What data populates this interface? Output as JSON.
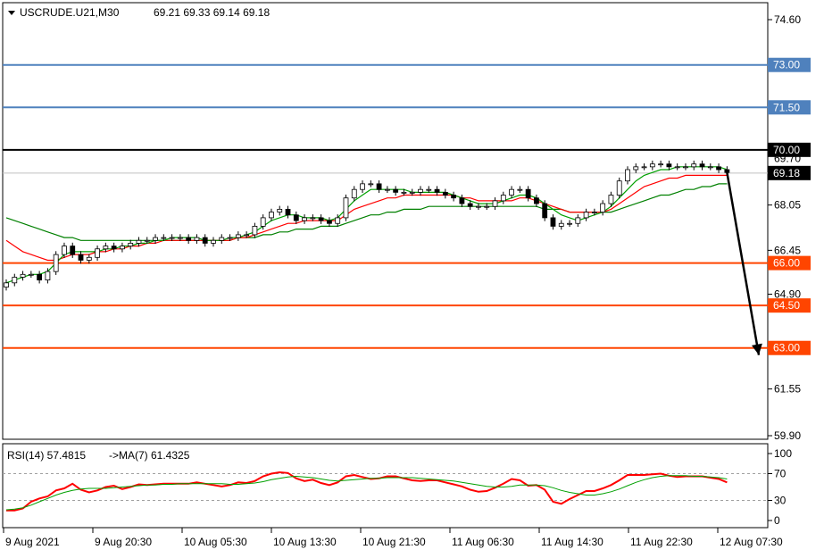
{
  "header": {
    "symbol": "USCRUDE.U21,M30",
    "ohlc": "69.21 69.33 69.14 69.18"
  },
  "rsi_header": {
    "label": "RSI(14) 57.4815",
    "ma_label": "->MA(7) 61.4325"
  },
  "chart_data": {
    "type": "candlestick",
    "price_axis": {
      "range": [
        59.9,
        74.6
      ],
      "ticks": [
        "74.60",
        "71.55",
        "68.05",
        "66.45",
        "64.90",
        "61.55",
        "59.90"
      ]
    },
    "x_labels": [
      "9 Aug 2021",
      "9 Aug 20:30",
      "10 Aug 05:30",
      "10 Aug 13:30",
      "10 Aug 21:30",
      "11 Aug 06:30",
      "11 Aug 14:30",
      "11 Aug 22:30",
      "12 Aug 07:30"
    ],
    "levels": [
      {
        "value": 73.0,
        "label": "73.00",
        "color": "#4f81bd"
      },
      {
        "value": 71.5,
        "label": "71.50",
        "color": "#4f81bd"
      },
      {
        "value": 70.0,
        "label": "70.00",
        "color": "#000000"
      },
      {
        "value": 66.0,
        "label": "66.00",
        "color": "#ff4500"
      },
      {
        "value": 64.5,
        "label": "64.50",
        "color": "#ff4500"
      },
      {
        "value": 63.0,
        "label": "63.00",
        "color": "#ff4500"
      }
    ],
    "current_price": {
      "value": 69.18,
      "label": "69.18"
    },
    "partial_tick": "69.70",
    "close_series": [
      65.3,
      65.5,
      65.6,
      65.6,
      65.4,
      65.7,
      66.3,
      66.6,
      66.3,
      66.1,
      66.2,
      66.5,
      66.6,
      66.5,
      66.6,
      66.7,
      66.8,
      66.8,
      66.9,
      66.9,
      66.9,
      66.9,
      66.8,
      66.9,
      66.7,
      66.8,
      66.9,
      66.9,
      67.0,
      67.0,
      67.3,
      67.6,
      67.8,
      67.9,
      67.7,
      67.5,
      67.6,
      67.6,
      67.5,
      67.4,
      67.6,
      68.3,
      68.6,
      68.8,
      68.8,
      68.6,
      68.6,
      68.5,
      68.5,
      68.5,
      68.6,
      68.6,
      68.5,
      68.4,
      68.3,
      68.1,
      68.0,
      68.0,
      68.0,
      68.2,
      68.4,
      68.6,
      68.6,
      68.3,
      68.1,
      67.6,
      67.3,
      67.4,
      67.4,
      67.6,
      67.8,
      67.8,
      68.1,
      68.4,
      68.9,
      69.3,
      69.4,
      69.4,
      69.5,
      69.5,
      69.4,
      69.4,
      69.4,
      69.5,
      69.4,
      69.4,
      69.3,
      69.2
    ],
    "ma_fast": [
      65.3,
      65.4,
      65.5,
      65.6,
      65.6,
      65.7,
      66.0,
      66.3,
      66.4,
      66.4,
      66.4,
      66.4,
      66.5,
      66.5,
      66.6,
      66.6,
      66.7,
      66.7,
      66.8,
      66.8,
      66.9,
      66.9,
      66.9,
      66.9,
      66.8,
      66.8,
      66.8,
      66.9,
      66.9,
      67.0,
      67.1,
      67.3,
      67.5,
      67.6,
      67.7,
      67.7,
      67.6,
      67.6,
      67.6,
      67.5,
      67.6,
      67.9,
      68.2,
      68.4,
      68.6,
      68.6,
      68.6,
      68.6,
      68.6,
      68.5,
      68.5,
      68.5,
      68.5,
      68.5,
      68.4,
      68.3,
      68.2,
      68.1,
      68.1,
      68.1,
      68.2,
      68.3,
      68.4,
      68.4,
      68.3,
      68.1,
      67.9,
      67.7,
      67.6,
      67.5,
      67.6,
      67.7,
      67.8,
      68.0,
      68.3,
      68.6,
      68.9,
      69.1,
      69.2,
      69.3,
      69.3,
      69.4,
      69.4,
      69.4,
      69.4,
      69.4,
      69.4,
      69.3
    ],
    "ma_mid": [
      66.8,
      66.6,
      66.4,
      66.3,
      66.2,
      66.1,
      66.1,
      66.2,
      66.3,
      66.3,
      66.3,
      66.4,
      66.4,
      66.5,
      66.5,
      66.6,
      66.6,
      66.7,
      66.7,
      66.8,
      66.8,
      66.8,
      66.8,
      66.8,
      66.8,
      66.8,
      66.8,
      66.8,
      66.9,
      66.9,
      67.0,
      67.1,
      67.2,
      67.3,
      67.4,
      67.4,
      67.5,
      67.5,
      67.5,
      67.5,
      67.5,
      67.7,
      67.9,
      68.0,
      68.1,
      68.2,
      68.3,
      68.3,
      68.4,
      68.4,
      68.4,
      68.4,
      68.4,
      68.4,
      68.4,
      68.3,
      68.3,
      68.2,
      68.2,
      68.2,
      68.2,
      68.2,
      68.3,
      68.3,
      68.2,
      68.1,
      68.0,
      67.9,
      67.8,
      67.8,
      67.8,
      67.8,
      67.8,
      67.9,
      68.1,
      68.3,
      68.5,
      68.7,
      68.8,
      68.9,
      69.0,
      69.0,
      69.1,
      69.1,
      69.1,
      69.1,
      69.1,
      69.1
    ],
    "ma_slow": [
      67.6,
      67.5,
      67.4,
      67.3,
      67.2,
      67.1,
      67.0,
      66.9,
      66.9,
      66.8,
      66.8,
      66.8,
      66.8,
      66.8,
      66.8,
      66.8,
      66.8,
      66.8,
      66.8,
      66.8,
      66.8,
      66.8,
      66.8,
      66.8,
      66.8,
      66.8,
      66.8,
      66.8,
      66.9,
      66.9,
      66.9,
      67.0,
      67.0,
      67.1,
      67.1,
      67.2,
      67.2,
      67.2,
      67.3,
      67.3,
      67.3,
      67.4,
      67.5,
      67.6,
      67.7,
      67.7,
      67.8,
      67.8,
      67.9,
      67.9,
      67.9,
      68.0,
      68.0,
      68.0,
      68.0,
      68.0,
      68.0,
      68.0,
      68.0,
      68.0,
      68.0,
      68.0,
      68.0,
      68.0,
      68.0,
      67.9,
      67.9,
      67.9,
      67.8,
      67.8,
      67.8,
      67.8,
      67.8,
      67.8,
      67.9,
      68.0,
      68.1,
      68.2,
      68.3,
      68.4,
      68.4,
      68.5,
      68.6,
      68.6,
      68.7,
      68.7,
      68.8,
      68.8
    ],
    "rsi_axis": {
      "ticks": [
        "100",
        "70",
        "30",
        "0"
      ],
      "levels": [
        70,
        30
      ]
    },
    "rsi_series": [
      15,
      15,
      18,
      28,
      33,
      36,
      45,
      48,
      55,
      46,
      42,
      45,
      50,
      52,
      47,
      50,
      54,
      53,
      54,
      55,
      55,
      55,
      55,
      57,
      55,
      53,
      51,
      53,
      57,
      56,
      59,
      66,
      70,
      72,
      71,
      63,
      59,
      61,
      56,
      53,
      57,
      66,
      68,
      65,
      62,
      63,
      66,
      66,
      63,
      60,
      59,
      60,
      60,
      57,
      54,
      51,
      46,
      43,
      44,
      49,
      55,
      62,
      60,
      52,
      53,
      46,
      28,
      25,
      32,
      38,
      44,
      44,
      48,
      53,
      60,
      68,
      68,
      68,
      69,
      70,
      67,
      65,
      66,
      66,
      66,
      64,
      62,
      57
    ],
    "rsi_ma": [
      16,
      17,
      19,
      23,
      28,
      33,
      38,
      42,
      45,
      47,
      48,
      48,
      48,
      49,
      50,
      51,
      52,
      53,
      53,
      54,
      54,
      55,
      55,
      55,
      55,
      55,
      55,
      54,
      54,
      55,
      56,
      58,
      61,
      63,
      65,
      66,
      65,
      64,
      62,
      60,
      59,
      60,
      61,
      62,
      63,
      63,
      64,
      64,
      64,
      64,
      63,
      62,
      61,
      60,
      59,
      57,
      55,
      53,
      51,
      50,
      50,
      51,
      53,
      53,
      53,
      52,
      49,
      45,
      42,
      40,
      38,
      38,
      40,
      43,
      47,
      52,
      57,
      61,
      64,
      66,
      67,
      67,
      67,
      66,
      66,
      65,
      64,
      62
    ]
  },
  "colors": {
    "candle_bull": "#ffffff",
    "candle_bear": "#000000",
    "ma_fast": "#00a000",
    "ma_mid": "#ff0000",
    "ma_slow": "#008000",
    "rsi_line": "#ff0000",
    "rsi_ma_line": "#00a000",
    "arrow": "#000000"
  }
}
